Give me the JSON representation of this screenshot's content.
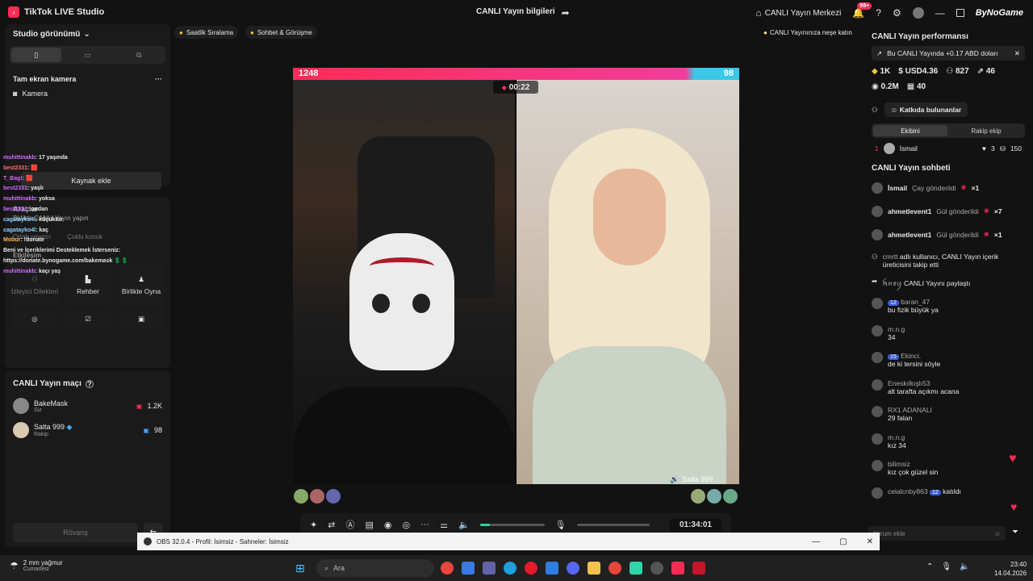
{
  "window": {
    "app_title": "TikTok LIVE Studio",
    "center_title": "CANLI Yayın bilgileri",
    "center_title_alt": "CANLI Yayın Merkezi",
    "notif_badge": "99+",
    "logo_text": "ByNoGame"
  },
  "left": {
    "studio_view": "Studio görünümü",
    "source_title": "Tam ekran kamera",
    "source_item": "Camera",
    "source_item_tr": "Kamera",
    "add_source": "Kaynak ekle",
    "tools_title": "Araçlar",
    "collab_btn": "Birlikte CANLI Yayın yapın",
    "collab_sub1": "Ortak yayıncı",
    "collab_sub2": "Çoklu konuk",
    "interaction_title": "Etkileşim",
    "interaction": [
      {
        "label": "İzleyici Dilekleri",
        "icon": "viewers-icon"
      },
      {
        "label": "Rehber",
        "icon": "guide-icon"
      },
      {
        "label": "Birlikte Oyna",
        "icon": "play-together-icon"
      }
    ],
    "overlay_chat": [
      {
        "u": "muhittinakb",
        "t": "17 yaşında",
        "c": "n1"
      },
      {
        "u": "best2331",
        "t": "🟥",
        "c": "n2"
      },
      {
        "u": "T_Bag!",
        "t": "🟥",
        "c": "n1"
      },
      {
        "u": "best2331",
        "t": "yaşlı",
        "c": "n1"
      },
      {
        "u": "muhittinakb",
        "t": "yoksa",
        "c": "n1"
      },
      {
        "u": "best2331",
        "t": "ondan",
        "c": "n1"
      },
      {
        "u": "cagatayko4l",
        "t": "küçüktür",
        "c": "n3"
      },
      {
        "u": "",
        "t": "",
        "c": "n3"
      },
      {
        "u": "cagatayko4l",
        "t": "kaç",
        "c": "n3"
      },
      {
        "u": "Mobur",
        "t": "!donate",
        "c": "n4"
      },
      {
        "u": "",
        "t": "Beni ve İçeriklerimi Desteklemek İsterseniz:",
        "c": "n3"
      },
      {
        "u": "",
        "t": "https://donate.bynogame.com/bakemask 💲💲",
        "c": "n3"
      },
      {
        "u": "muhittinakb",
        "t": "kaçı yaş",
        "c": "n1"
      }
    ],
    "match_title": "CANLI Yayın maçı",
    "match": [
      {
        "name": "BakeMask",
        "sub": "Siz",
        "score": "1.2K"
      },
      {
        "name": "Salta 999",
        "sub": "Rakip",
        "score": "98"
      }
    ],
    "rematch": "Rövanş"
  },
  "top_pills": {
    "p1": "Saatlik Sıralama",
    "p2": "Sohbet & Görüşme",
    "p3": "CANLI Yayınınıza neşe katın"
  },
  "stage": {
    "score_left": "1248",
    "score_right": "98",
    "timer": "00:22",
    "opponent_label": "Salta 999...",
    "elapsed": "01:34:01",
    "volume": 0.15
  },
  "right": {
    "perf_title": "CANLI Yayın performansı",
    "perf_banner": "Bu CANLI Yayında +0.17 ABD doları",
    "stats": {
      "diamonds": "1K",
      "usd": "USD4.36",
      "followers": "827",
      "shares": "46",
      "views": "0.2M",
      "gifts": "40"
    },
    "contributors_btn": "Katkıda bulunanlar",
    "tab_mine": "Ekibini",
    "tab_rival": "Rakip ekip",
    "top_contrib": {
      "rank": "1",
      "name": "İsmail",
      "hearts": "3",
      "coins": "150"
    },
    "chat_title": "CANLI Yayın sohbeti",
    "chat": [
      {
        "u": "İsmail",
        "t": "Çay gönderildi",
        "x": "×1",
        "kind": "gift"
      },
      {
        "u": "ahmetlevent1",
        "t": "Gül gönderildi",
        "x": "×7",
        "kind": "gift"
      },
      {
        "u": "ahmetlevent1",
        "t": "Gül gönderildi",
        "x": "×1",
        "kind": "gift"
      }
    ],
    "events": [
      {
        "u": "cmrtt",
        "t": "adlı kullanıcı, CANLI Yayın içerik üreticisini takip etti"
      },
      {
        "u": "ꫝꪀꫀꪗ",
        "t": "CANLI Yayını paylaştı"
      }
    ],
    "comments": [
      {
        "u": "baran_47",
        "lvl": "12",
        "t": "bu fizik büyük ya"
      },
      {
        "u": "m.n.g",
        "lvl": "",
        "t": "34"
      },
      {
        "u": "Ekinci.",
        "lvl": "15",
        "t": "de ki tersini söyle"
      },
      {
        "u": "Eneskılkışlı53",
        "lvl": "",
        "t": "alt tarafta açıkmı acana"
      },
      {
        "u": "RX1 ADANALI",
        "lvl": "",
        "t": "29 falan"
      },
      {
        "u": "m.n.g",
        "lvl": "",
        "t": "kız 34"
      },
      {
        "u": "bilimsiz",
        "lvl": "",
        "t": "kız çok güzel sin"
      },
      {
        "u": "celalcnby863",
        "lvl": "12",
        "t": "katıldı"
      }
    ],
    "comment_placeholder": "Yorum ekle"
  },
  "obs": {
    "title": "OBS 32.0.4 - Profil: İsimsiz - Sahneler: İsimsiz"
  },
  "taskbar": {
    "weather": "2 mm yağmur",
    "weather_sub": "Cumartesi",
    "search": "Ara",
    "time": "23:40",
    "date": "14.04.2026"
  }
}
